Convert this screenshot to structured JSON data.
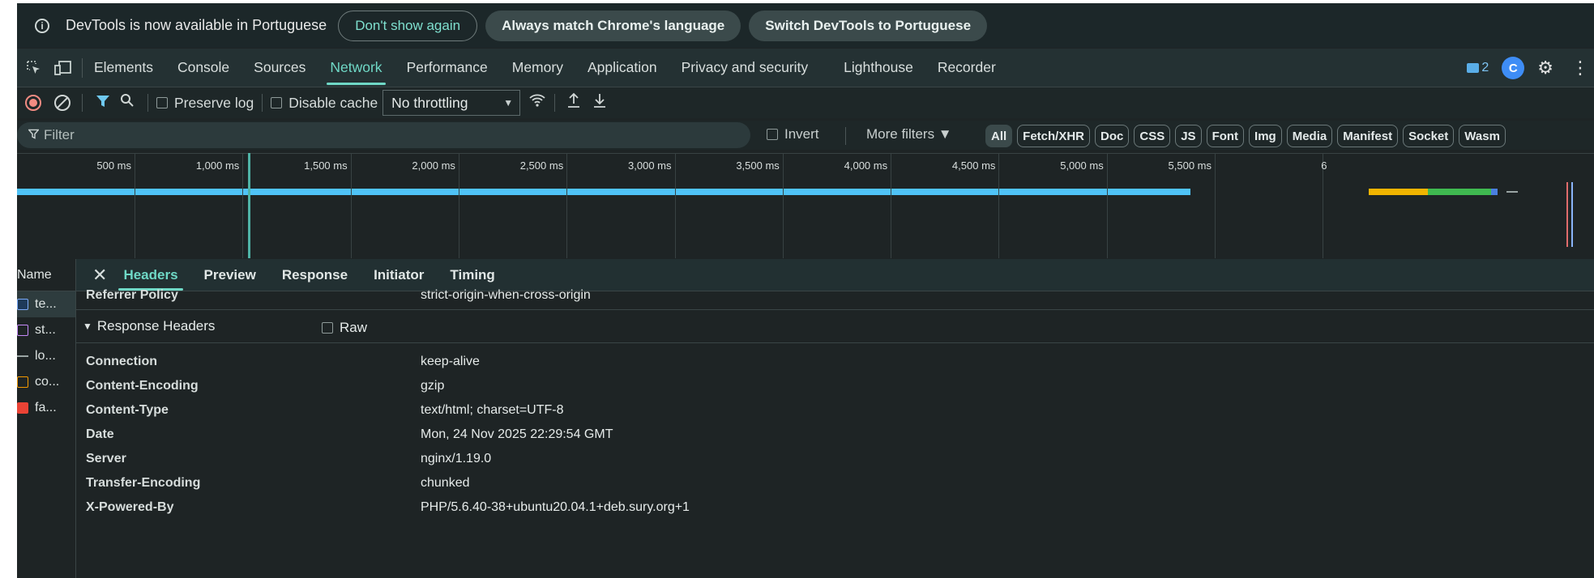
{
  "infobar": {
    "message": "DevTools is now available in Portuguese",
    "btn_dont_show": "Don't show again",
    "btn_always_match": "Always match Chrome's language",
    "btn_switch": "Switch DevTools to Portuguese"
  },
  "tabs": [
    "Elements",
    "Console",
    "Sources",
    "Network",
    "Performance",
    "Memory",
    "Application",
    "Privacy and security",
    "Lighthouse",
    "Recorder"
  ],
  "active_tab": "Network",
  "issues_count": "2",
  "toolbar": {
    "preserve_log": "Preserve log",
    "disable_cache": "Disable cache",
    "throttling": "No throttling"
  },
  "filter": {
    "placeholder": "Filter",
    "invert": "Invert",
    "more_filters": "More filters ▼",
    "chips": [
      "All",
      "Fetch/XHR",
      "Doc",
      "CSS",
      "JS",
      "Font",
      "Img",
      "Media",
      "Manifest",
      "Socket",
      "Wasm"
    ]
  },
  "timeline": {
    "labels": [
      "500 ms",
      "1,000 ms",
      "1,500 ms",
      "2,000 ms",
      "2,500 ms",
      "3,000 ms",
      "3,500 ms",
      "4,000 ms",
      "4,500 ms",
      "5,000 ms",
      "5,500 ms",
      "6"
    ],
    "colors": {
      "blue": "#4fc3f7",
      "orange": "#f0b400",
      "green": "#3fb950"
    }
  },
  "requests": {
    "header": "Name",
    "items": [
      {
        "name": "te...",
        "icon": "document-icon"
      },
      {
        "name": "st...",
        "icon": "stylesheet-icon"
      },
      {
        "name": "lo...",
        "icon": "other-icon"
      },
      {
        "name": "co...",
        "icon": "script-icon"
      },
      {
        "name": "fa...",
        "icon": "image-icon"
      }
    ]
  },
  "detail": {
    "tabs": [
      "Headers",
      "Preview",
      "Response",
      "Initiator",
      "Timing"
    ],
    "active_tab": "Headers",
    "referrer": {
      "key": "Referrer Policy",
      "value": "strict-origin-when-cross-origin"
    },
    "response_section": "Response Headers",
    "raw_label": "Raw",
    "headers": [
      {
        "key": "Connection",
        "value": "keep-alive"
      },
      {
        "key": "Content-Encoding",
        "value": "gzip"
      },
      {
        "key": "Content-Type",
        "value": "text/html; charset=UTF-8"
      },
      {
        "key": "Date",
        "value": "Mon, 24 Nov 2025 22:29:54 GMT"
      },
      {
        "key": "Server",
        "value": "nginx/1.19.0"
      },
      {
        "key": "Transfer-Encoding",
        "value": "chunked"
      },
      {
        "key": "X-Powered-By",
        "value": "PHP/5.6.40-38+ubuntu20.04.1+deb.sury.org+1"
      }
    ]
  }
}
